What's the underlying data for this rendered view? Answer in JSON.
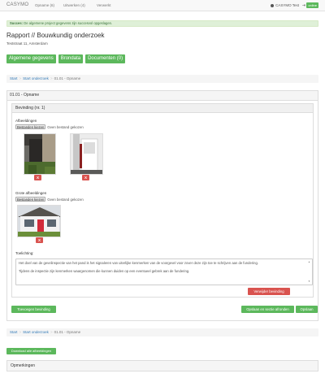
{
  "nav": {
    "brand": "CASYMO",
    "links": [
      "Opname (6)",
      "Uitwerken (4)",
      "Verwerkt"
    ],
    "user": "CASYMO Test",
    "status": "online"
  },
  "alert": {
    "strong": "Succes:",
    "message": " De algemene project gegevens zijn succesvol opgeslagen."
  },
  "header": {
    "title": "Rapport // Bouwkundig onderzoek",
    "address": "Teststraat 11, Amsterdam"
  },
  "tabs": [
    "Algemene gegevens",
    "Brondata",
    "Documenten (0)"
  ],
  "breadcrumb": {
    "items": [
      "Start",
      "Start onderzoek",
      "01.01 - Opname"
    ]
  },
  "section": {
    "title": "01.01 - Opname",
    "finding_title": "Bevinding (nr. 1)"
  },
  "images_field": {
    "label": "Afbeeldingen",
    "button": "Bestanden kiezen",
    "no_file": "Geen bestand gekozen"
  },
  "large_images_field": {
    "label": "Grote afbeeldingen",
    "button": "Bestanden kiezen",
    "no_file": "Geen bestand gekozen"
  },
  "explanation": {
    "label": "Toelichting:",
    "paragraph1": "Het doel van de gevelinspectie van het pand is het signaleren van uiterlijke kenmerken van de voorgevel voor zover deze zijn toe te schrijven aan de fundering.",
    "paragraph2": "Tijdens de inspectie zijn kenmerken waargenomen die kunnen duiden op een eventueel gebrek aan de fundering."
  },
  "buttons": {
    "delete_x": "X",
    "remove_finding": "Verwijder bevinding",
    "add_finding": "Toevoegen bevinding",
    "save_finish": "Opslaan en sectie afronden",
    "save": "Opslaan",
    "download_all": "Download alle afbeeldingen"
  },
  "remarks": {
    "title": "Opmerkingen"
  },
  "colors": {
    "success": "#5cb85c",
    "danger": "#d9534f",
    "link": "#337ab7"
  }
}
